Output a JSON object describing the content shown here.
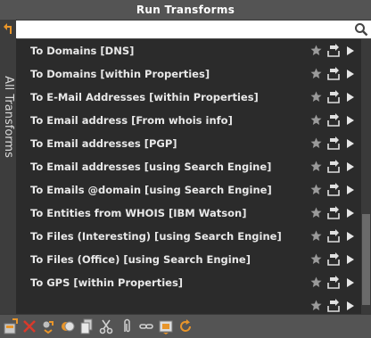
{
  "window": {
    "title": "Run Transforms"
  },
  "side_tab": {
    "label": "All Transforms"
  },
  "search": {
    "value": "",
    "placeholder": ""
  },
  "transforms": [
    {
      "label": "To Domains [DNS]"
    },
    {
      "label": "To Domains [within Properties]"
    },
    {
      "label": "To E-Mail Addresses [within Properties]"
    },
    {
      "label": "To Email address [From whois info]"
    },
    {
      "label": "To Email addresses [PGP]"
    },
    {
      "label": "To Email addresses [using Search Engine]"
    },
    {
      "label": "To Emails @domain [using Search Engine]"
    },
    {
      "label": "To Entities from WHOIS [IBM Watson]"
    },
    {
      "label": "To Files (Interesting) [using Search Engine]"
    },
    {
      "label": "To Files (Office) [using Search Engine]"
    },
    {
      "label": "To GPS [within Properties]"
    },
    {
      "label": ""
    }
  ],
  "colors": {
    "accent_orange": "#e8952a",
    "delete_red": "#d93a2b",
    "list_bg": "#2b2b2b",
    "text": "#e8e8e8",
    "icon_grey": "#9a9a9a"
  },
  "toolbar_icons": [
    "new-transform-icon",
    "delete-icon",
    "machine-icon",
    "toggle-icon",
    "copy-icon",
    "cut-icon",
    "attach-icon",
    "link-icon",
    "frame-icon",
    "refresh-icon"
  ]
}
